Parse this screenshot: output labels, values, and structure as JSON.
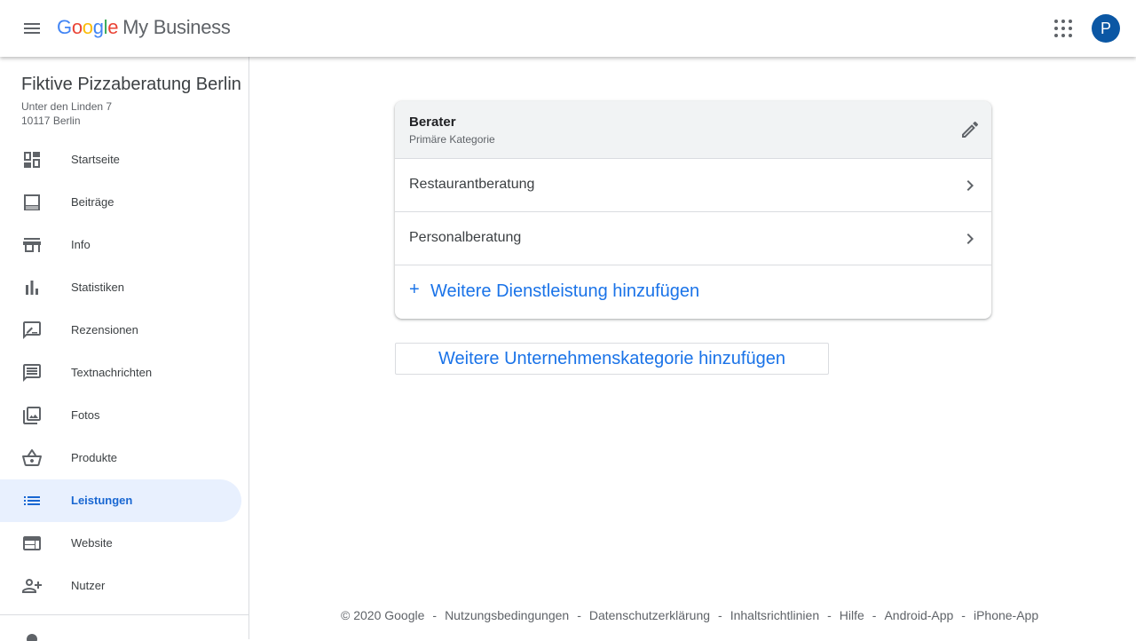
{
  "header": {
    "logo_letters": [
      "G",
      "o",
      "o",
      "g",
      "l",
      "e"
    ],
    "product_name": "My Business",
    "avatar_initial": "P",
    "icons": {
      "menu": "hamburger-menu-icon",
      "apps": "apps-grid-icon"
    }
  },
  "business": {
    "name": "Fiktive Pizzaberatung Berlin",
    "address_line1": "Unter den Linden 7",
    "address_line2": "10117 Berlin"
  },
  "sidebar": {
    "items": [
      {
        "label": "Startseite",
        "icon": "dashboard-icon",
        "active": false
      },
      {
        "label": "Beiträge",
        "icon": "posts-icon",
        "active": false
      },
      {
        "label": "Info",
        "icon": "storefront-icon",
        "active": false
      },
      {
        "label": "Statistiken",
        "icon": "bar-chart-icon",
        "active": false
      },
      {
        "label": "Rezensionen",
        "icon": "rate-review-icon",
        "active": false
      },
      {
        "label": "Textnachrichten",
        "icon": "message-icon",
        "active": false
      },
      {
        "label": "Fotos",
        "icon": "photo-library-icon",
        "active": false
      },
      {
        "label": "Produkte",
        "icon": "basket-icon",
        "active": false
      },
      {
        "label": "Leistungen",
        "icon": "list-icon",
        "active": true
      },
      {
        "label": "Website",
        "icon": "web-icon",
        "active": false
      },
      {
        "label": "Nutzer",
        "icon": "person-add-icon",
        "active": false
      }
    ]
  },
  "colors": {
    "accent": "#1a73e8",
    "active_bg": "#e8f0fe",
    "active_text": "#1967d2",
    "avatar_bg": "#0b57a4"
  },
  "card": {
    "category_title": "Berater",
    "category_subtitle": "Primäre Kategorie",
    "services": [
      "Restaurantberatung",
      "Personalberatung"
    ],
    "add_service_plus": "+",
    "add_service_label": "Weitere Dienstleistung hinzufügen"
  },
  "add_category_label": "Weitere Unternehmenskategorie hinzufügen",
  "footer": {
    "separator": "-",
    "copyright": "© 2020 Google",
    "links": [
      "Nutzungsbedingungen",
      "Datenschutzerklärung",
      "Inhaltsrichtlinien",
      "Hilfe",
      "Android-App",
      "iPhone-App"
    ]
  }
}
